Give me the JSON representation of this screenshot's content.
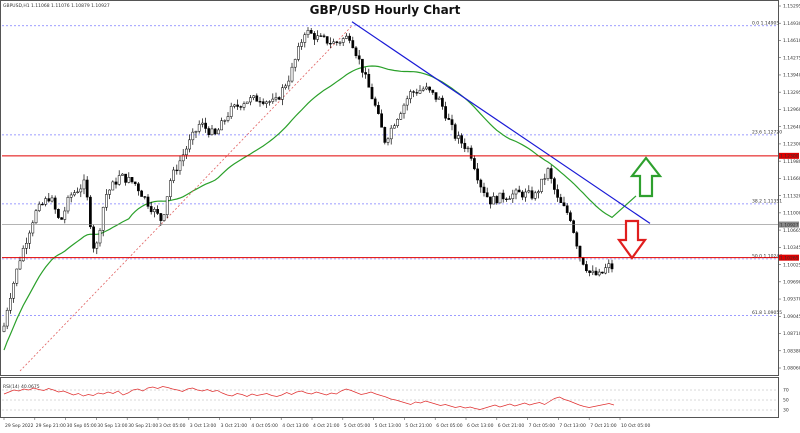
{
  "chart_data": {
    "type": "candlestick",
    "title": "GBP/USD Hourly Chart",
    "info": "GBPUSD,H1  1.11068 1.11076 1.10879 1.10927",
    "y_ticks": [
      "1.15295",
      "1.14930",
      "1.14610",
      "1.14275",
      "1.13940",
      "1.13295",
      "1.12960",
      "1.12640",
      "1.12300",
      "1.11980",
      "1.11660",
      "1.11320",
      "1.11000",
      "1.10665",
      "1.10345",
      "1.10025",
      "1.09690",
      "1.09370",
      "1.09045",
      "1.08710",
      "1.08380",
      "1.08060"
    ],
    "x_ticks": [
      "29 Sep 2022",
      "29 Sep 21:00",
      "30 Sep 05:00",
      "30 Sep 13:00",
      "30 Sep 21:00",
      "3 Oct 05:00",
      "3 Oct 13:00",
      "3 Oct 21:00",
      "4 Oct 05:00",
      "4 Oct 13:00",
      "4 Oct 21:00",
      "5 Oct 05:00",
      "5 Oct 13:00",
      "5 Oct 21:00",
      "6 Oct 05:00",
      "6 Oct 13:00",
      "6 Oct 21:00",
      "7 Oct 05:00",
      "7 Oct 13:00",
      "7 Oct 21:00",
      "10 Oct 05:00"
    ],
    "horizontal_lines": [
      {
        "price": 1.123,
        "label": "1.12300",
        "color": "#e00000"
      },
      {
        "price": 1.10265,
        "label": "1.10265",
        "color": "#e00000"
      },
      {
        "price": 1.10927,
        "label": "1.10927",
        "color": "#888888"
      }
    ],
    "fib_levels": [
      {
        "price": 1.149,
        "label": "0.0  1.14905",
        "color": "#7c7cff"
      },
      {
        "price": 1.1272,
        "label": "23.6  1.12720",
        "color": "#7c7cff"
      },
      {
        "price": 1.1134,
        "label": "38.2  1.11351",
        "color": "#7c7cff"
      },
      {
        "price": 1.1024,
        "label": "50.0  1.10244",
        "color": "#7c7cff"
      },
      {
        "price": 1.0911,
        "label": "61.8  1.09055",
        "color": "#7c7cff"
      }
    ],
    "trendline": {
      "from_price": 1.1498,
      "to_price": 1.1095,
      "color": "#1a1ad6"
    },
    "moving_average_color": "#2aa02a",
    "rsi": {
      "label": "RSI(14) 40.0675",
      "levels": [
        "70",
        "50",
        "30"
      ],
      "color": "#e03030",
      "values": [
        62,
        66,
        70,
        68,
        72,
        70,
        74,
        71,
        69,
        73,
        70,
        66,
        68,
        64,
        60,
        63,
        58,
        61,
        59,
        64,
        62,
        66,
        63,
        68,
        60,
        64,
        70,
        72,
        68,
        74,
        76,
        73,
        77,
        75,
        72,
        70,
        67,
        72,
        74,
        70,
        68,
        71,
        67,
        69,
        64,
        60,
        58,
        63,
        61,
        57,
        62,
        59,
        61,
        63,
        59,
        57,
        60,
        65,
        61,
        66,
        68,
        64,
        62,
        66,
        63,
        60,
        64,
        62,
        68,
        72,
        69,
        65,
        61,
        63,
        66,
        62,
        59,
        56,
        52,
        50,
        47,
        44,
        41,
        46,
        44,
        48,
        45,
        42,
        39,
        41,
        38,
        35,
        37,
        34,
        36,
        33,
        31,
        34,
        37,
        40,
        36,
        39,
        42,
        38,
        41,
        44,
        40,
        43,
        45,
        41,
        47,
        53,
        56,
        51,
        48,
        44,
        40,
        37,
        35,
        37,
        39,
        41,
        43,
        40
      ]
    },
    "up_arrow_color": "#2ea02e",
    "down_arrow_color": "#e01e1e"
  }
}
